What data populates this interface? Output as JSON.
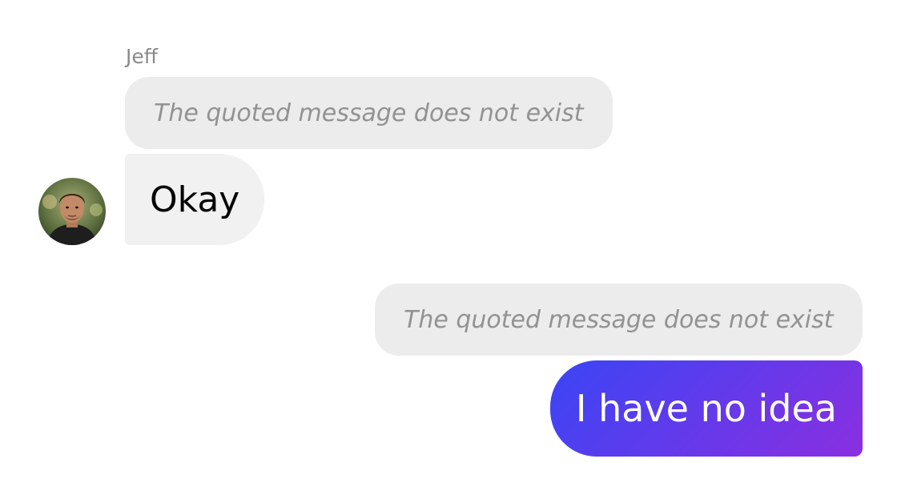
{
  "conversation": {
    "incoming": {
      "sender_name": "Jeff",
      "quote_text": "The quoted message does not exist",
      "message_text": "Okay",
      "avatar": "person-avatar"
    },
    "outgoing": {
      "quote_text": "The quoted message does not exist",
      "message_text": "I have no idea"
    }
  },
  "colors": {
    "background": "#ffffff",
    "quote_bubble": "#ececec",
    "incoming_bubble": "#f1f1f1",
    "outgoing_gradient_start": "#3a45f5",
    "outgoing_gradient_end": "#8a2fe0",
    "muted_text": "#929292"
  }
}
